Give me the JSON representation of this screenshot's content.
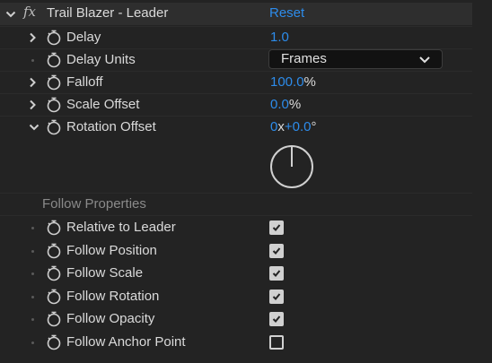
{
  "effect": {
    "fx_glyph": "fx",
    "name": "Trail Blazer - Leader",
    "reset_label": "Reset"
  },
  "properties": {
    "delay": {
      "label": "Delay",
      "value": "1.0"
    },
    "delay_units": {
      "label": "Delay Units",
      "selected": "Frames"
    },
    "falloff": {
      "label": "Falloff",
      "value": "100.0",
      "unit": "%"
    },
    "scale_offset": {
      "label": "Scale Offset",
      "value": "0.0",
      "unit": "%"
    },
    "rotation_offset": {
      "label": "Rotation Offset",
      "revolutions": "0",
      "x_sep": "x",
      "degrees": "+0.0",
      "degree_unit": "°"
    }
  },
  "follow": {
    "section_label": "Follow Properties",
    "items": [
      {
        "label": "Relative to Leader",
        "checked": true
      },
      {
        "label": "Follow Position",
        "checked": true
      },
      {
        "label": "Follow Scale",
        "checked": true
      },
      {
        "label": "Follow Rotation",
        "checked": true
      },
      {
        "label": "Follow Opacity",
        "checked": true
      },
      {
        "label": "Follow Anchor Point",
        "checked": false
      }
    ]
  },
  "colors": {
    "background": "#232323",
    "header": "#2e2e2e",
    "value_blue": "#2d8ceb",
    "text": "#dadada",
    "muted": "#8a8a8a"
  },
  "icons": {
    "twirl_open": "chevron-down-icon",
    "twirl_closed": "chevron-right-icon",
    "stopwatch": "stopwatch-icon",
    "dropdown": "chevron-down-icon"
  }
}
